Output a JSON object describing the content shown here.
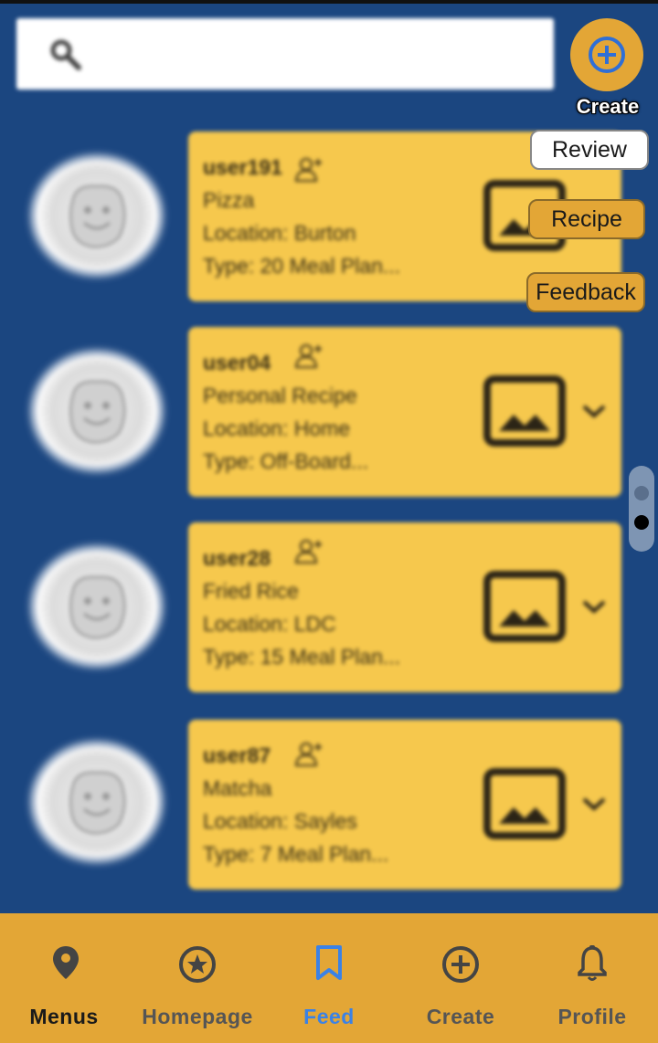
{
  "create_button": {
    "label": "Create"
  },
  "filters": [
    {
      "label": "Review"
    },
    {
      "label": "Recipe"
    },
    {
      "label": "Feedback"
    }
  ],
  "posts": [
    {
      "username": "user191",
      "title": "Pizza",
      "location": "Location: Burton",
      "type": "Type: 20 Meal Plan..."
    },
    {
      "username": "user04",
      "title": "Personal Recipe",
      "location": "Location: Home",
      "type": "Type: Off-Board..."
    },
    {
      "username": "user28",
      "title": "Fried Rice",
      "location": "Location: LDC",
      "type": "Type: 15 Meal Plan..."
    },
    {
      "username": "user87",
      "title": "Matcha",
      "location": "Location: Sayles",
      "type": "Type: 7 Meal Plan..."
    }
  ],
  "page_indicator": {
    "current": 2,
    "total": 2
  },
  "nav": {
    "items": [
      {
        "label": "Menus",
        "icon": "location-pin-icon"
      },
      {
        "label": "Homepage",
        "icon": "star-circle-icon"
      },
      {
        "label": "Feed",
        "icon": "bookmark-icon"
      },
      {
        "label": "Create",
        "icon": "plus-circle-icon"
      },
      {
        "label": "Profile",
        "icon": "bell-icon"
      }
    ],
    "active": "Feed"
  },
  "colors": {
    "background": "#1b4680",
    "card": "#f6c84d",
    "accent_orange": "#e3a636",
    "active_nav": "#3b82e6",
    "menus_label": "#1a1a1a"
  }
}
